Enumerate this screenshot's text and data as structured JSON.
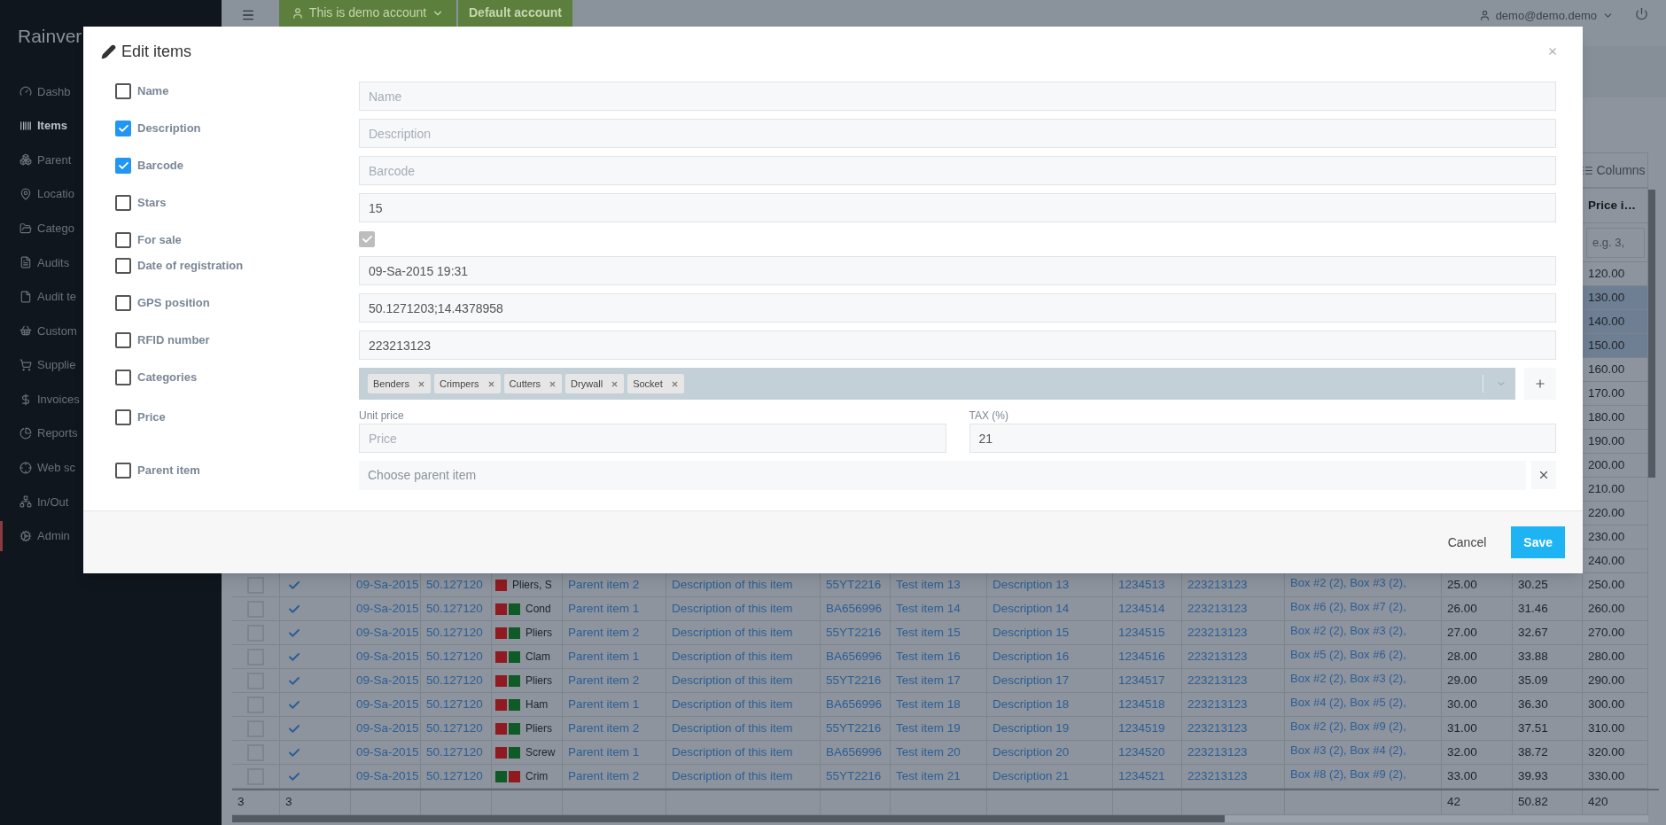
{
  "sidebar": {
    "logo": "Rainver",
    "items": [
      {
        "label": "Dashb",
        "selected": false,
        "marked": false
      },
      {
        "label": "Items",
        "selected": true,
        "marked": false
      },
      {
        "label": "Parent",
        "selected": false,
        "marked": false
      },
      {
        "label": "Locatio",
        "selected": false,
        "marked": false
      },
      {
        "label": "Catego",
        "selected": false,
        "marked": false
      },
      {
        "label": "Audits",
        "selected": false,
        "marked": false
      },
      {
        "label": "Audit te",
        "selected": false,
        "marked": false
      },
      {
        "label": "Custom",
        "selected": false,
        "marked": false
      },
      {
        "label": "Supplie",
        "selected": false,
        "marked": false
      },
      {
        "label": "Invoices",
        "selected": false,
        "marked": false
      },
      {
        "label": "Reports",
        "selected": false,
        "marked": false
      },
      {
        "label": "Web sc",
        "selected": false,
        "marked": false
      },
      {
        "label": "In/Out",
        "selected": false,
        "marked": false
      },
      {
        "label": "Admin",
        "selected": false,
        "marked": true
      }
    ]
  },
  "topbar": {
    "account": "This is demo account",
    "default_account": "Default account",
    "user": "demo@demo.demo"
  },
  "toolbar": {
    "columns_button": "Columns"
  },
  "table": {
    "header": "Price i…",
    "filter_placeholder": "e.g. 3,",
    "top_rows": [
      {
        "value": "120.00",
        "selected": false
      },
      {
        "value": "130.00",
        "selected": true
      },
      {
        "value": "140.00",
        "selected": true
      },
      {
        "value": "150.00",
        "selected": true
      },
      {
        "value": "160.00",
        "selected": false
      },
      {
        "value": "170.00",
        "selected": false
      },
      {
        "value": "180.00",
        "selected": false
      },
      {
        "value": "190.00",
        "selected": false
      },
      {
        "value": "200.00",
        "selected": false
      },
      {
        "value": "210.00",
        "selected": false
      },
      {
        "value": "220.00",
        "selected": false
      },
      {
        "value": "230.00",
        "selected": false
      },
      {
        "value": "240.00",
        "selected": false
      }
    ],
    "rows": [
      {
        "selected": false,
        "tick": true,
        "date": "09-Sa-2015",
        "gps": "50.127120",
        "swatches": [
          {
            "color": "#8f1b20"
          }
        ],
        "name": "Pliers, S",
        "parent": "Parent item 2",
        "description": "Description of this item",
        "barcode": "55YT2216",
        "item": "Test item 13",
        "description_2": "Description 13",
        "number": "1234513",
        "rfid": "223213123",
        "boxes": "Box #2 (2), Box #3 (2),",
        "price": "25.00",
        "price_2": "30.25",
        "price_3": "250.00"
      },
      {
        "selected": false,
        "tick": true,
        "date": "09-Sa-2015",
        "gps": "50.127120",
        "swatches": [
          {
            "color": "#8f1b20"
          },
          {
            "color": "#0f5a26"
          }
        ],
        "name": "Cond",
        "parent": "Parent item 1",
        "description": "Description of this item",
        "barcode": "BA656996",
        "item": "Test item 14",
        "description_2": "Description 14",
        "number": "1234514",
        "rfid": "223213123",
        "boxes": "Box #6 (2), Box #7 (2),",
        "price": "26.00",
        "price_2": "31.46",
        "price_3": "260.00"
      },
      {
        "selected": false,
        "tick": true,
        "date": "09-Sa-2015",
        "gps": "50.127120",
        "name": "Pliers",
        "parent": "Parent item 2",
        "description": "Description of this item",
        "barcode": "55YT2216",
        "item": "Test item 15",
        "swatches": [
          {
            "color": "#8f1b20"
          },
          {
            "color": "#0f5a26"
          }
        ],
        "description_2": "Description 15",
        "number": "1234515",
        "rfid": "223213123",
        "boxes": "Box #2 (2), Box #3 (2),",
        "price": "27.00",
        "price_2": "32.67",
        "price_3": "270.00"
      },
      {
        "selected": false,
        "tick": true,
        "date": "09-Sa-2015",
        "gps": "50.127120",
        "swatches": [
          {
            "color": "#8f1b20"
          },
          {
            "color": "#0f5a26"
          }
        ],
        "name": "Clam",
        "parent": "Parent item 1",
        "description": "Description of this item",
        "barcode": "BA656996",
        "item": "Test item 16",
        "description_2": "Description 16",
        "number": "1234516",
        "rfid": "223213123",
        "boxes": "Box #5 (2), Box #6 (2),",
        "price": "28.00",
        "price_2": "33.88",
        "price_3": "280.00"
      },
      {
        "selected": false,
        "tick": true,
        "date": "09-Sa-2015",
        "gps": "50.127120",
        "name": "Pliers",
        "parent": "Parent item 2",
        "description": "Description of this item",
        "barcode": "55YT2216",
        "item": "Test item 17",
        "swatches": [
          {
            "color": "#8f1b20"
          },
          {
            "color": "#0f5a26"
          }
        ],
        "description_2": "Description 17",
        "number": "1234517",
        "rfid": "223213123",
        "boxes": "Box #2 (2), Box #3 (2),",
        "price": "29.00",
        "price_2": "35.09",
        "price_3": "290.00"
      },
      {
        "selected": false,
        "tick": true,
        "date": "09-Sa-2015",
        "gps": "50.127120",
        "swatches": [
          {
            "color": "#8f1b20"
          },
          {
            "color": "#0f5a26"
          }
        ],
        "name": "Ham",
        "parent": "Parent item 1",
        "description": "Description of this item",
        "barcode": "BA656996",
        "item": "Test item 18",
        "description_2": "Description 18",
        "number": "1234518",
        "rfid": "223213123",
        "boxes": "Box #4 (2), Box #5 (2),",
        "price": "30.00",
        "price_2": "36.30",
        "price_3": "300.00"
      },
      {
        "selected": false,
        "tick": true,
        "date": "09-Sa-2015",
        "gps": "50.127120",
        "name": "Pliers",
        "parent": "Parent item 2",
        "description": "Description of this item",
        "barcode": "55YT2216",
        "item": "Test item 19",
        "swatches": [
          {
            "color": "#8f1b20"
          },
          {
            "color": "#0f5a26"
          }
        ],
        "description_2": "Description 19",
        "number": "1234519",
        "rfid": "223213123",
        "boxes": "Box #2 (2), Box #9 (2),",
        "price": "31.00",
        "price_2": "37.51",
        "price_3": "310.00"
      },
      {
        "selected": false,
        "tick": true,
        "date": "09-Sa-2015",
        "gps": "50.127120",
        "swatches": [
          {
            "color": "#8f1b20"
          },
          {
            "color": "#0f5a26"
          }
        ],
        "name": "Screw",
        "parent": "Parent item 1",
        "description": "Description of this item",
        "barcode": "BA656996",
        "item": "Test item 20",
        "description_2": "Description 20",
        "number": "1234520",
        "rfid": "223213123",
        "boxes": "Box #3 (2), Box #4 (2),",
        "price": "32.00",
        "price_2": "38.72",
        "price_3": "320.00"
      },
      {
        "selected": false,
        "tick": true,
        "date": "09-Sa-2015",
        "gps": "50.127120",
        "swatches": [
          {
            "color": "#0f5a26"
          },
          {
            "color": "#8f1b20"
          }
        ],
        "name": "Crim",
        "parent": "Parent item 2",
        "description": "Description of this item",
        "barcode": "55YT2216",
        "item": "Test item 21",
        "description_2": "Description 21",
        "number": "1234521",
        "rfid": "223213123",
        "boxes": "Box #8 (2), Box #9 (2),",
        "price": "33.00",
        "price_2": "39.93",
        "price_3": "330.00"
      }
    ],
    "footer": {
      "column_1": "3",
      "column_2": "3",
      "price": "42",
      "price_2": "50.82",
      "price_3": "420"
    }
  },
  "modal": {
    "title": "Edit items",
    "fields": [
      {
        "label": "Name",
        "checked": false,
        "kind": "text",
        "placeholder": "Name"
      },
      {
        "label": "Description",
        "checked": true,
        "kind": "text",
        "placeholder": "Description"
      },
      {
        "label": "Barcode",
        "checked": true,
        "kind": "text",
        "placeholder": "Barcode"
      },
      {
        "label": "Stars",
        "checked": false,
        "kind": "text",
        "value": "15"
      },
      {
        "label": "For sale",
        "checked": false,
        "kind": "checkbox",
        "value_checked": true
      },
      {
        "label": "Date of registration",
        "checked": false,
        "kind": "text",
        "value": "09-Sa-2015 19:31"
      },
      {
        "label": "GPS position",
        "checked": false,
        "kind": "text",
        "value": "50.1271203;14.4378958"
      },
      {
        "label": "RFID number",
        "checked": false,
        "kind": "text",
        "value": "223213123"
      },
      {
        "label": "Categories",
        "checked": false,
        "kind": "tags",
        "tags": [
          "Benders",
          "Crimpers",
          "Cutters",
          "Drywall",
          "Socket"
        ]
      },
      {
        "label": "Price",
        "checked": false,
        "kind": "price",
        "parts": [
          {
            "label": "Unit price",
            "placeholder": "Price"
          },
          {
            "label": "TAX (%)",
            "value": "21"
          }
        ]
      },
      {
        "label": "Parent item",
        "checked": false,
        "kind": "select",
        "placeholder": "Choose parent item"
      }
    ],
    "buttons": {
      "cancel": "Cancel",
      "save": "Save"
    }
  }
}
